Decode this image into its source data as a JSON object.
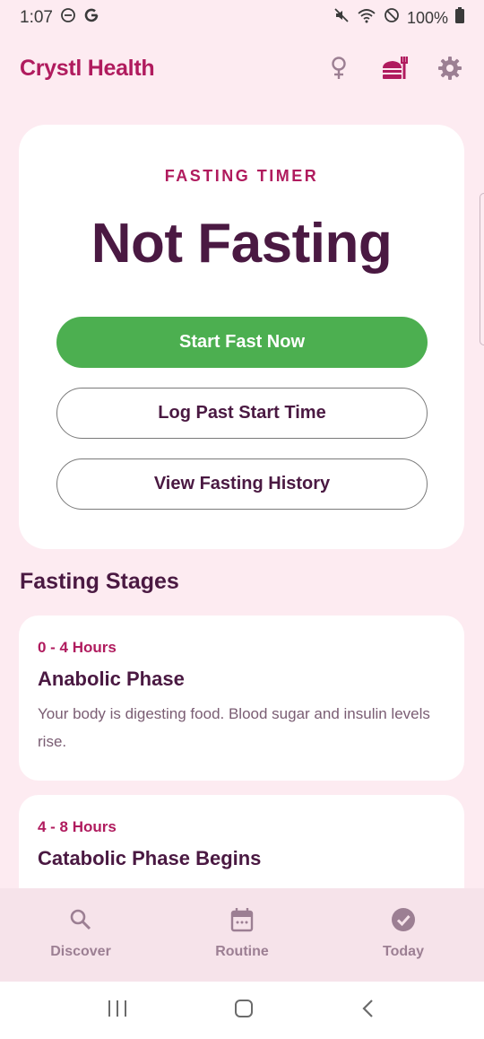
{
  "status_bar": {
    "time": "1:07",
    "battery": "100%"
  },
  "header": {
    "title": "Crystl Health",
    "icons": [
      "female-icon",
      "fasting-icon",
      "gear-icon"
    ]
  },
  "timer": {
    "label": "FASTING TIMER",
    "status": "Not Fasting",
    "start_button": "Start Fast Now",
    "log_button": "Log Past Start Time",
    "history_button": "View Fasting History"
  },
  "stages": {
    "title": "Fasting Stages",
    "items": [
      {
        "hours": "0 - 4 Hours",
        "name": "Anabolic Phase",
        "description": "Your body is digesting food. Blood sugar and insulin levels rise."
      },
      {
        "hours": "4 - 8 Hours",
        "name": "Catabolic Phase Begins",
        "description": ""
      }
    ]
  },
  "bottom_nav": {
    "items": [
      {
        "label": "Discover",
        "icon": "search-icon"
      },
      {
        "label": "Routine",
        "icon": "calendar-icon"
      },
      {
        "label": "Today",
        "icon": "check-circle-icon"
      }
    ]
  },
  "colors": {
    "accent": "#b01b5e",
    "primary_text": "#4a1942",
    "success": "#4caf50",
    "background": "#fdebf1"
  }
}
